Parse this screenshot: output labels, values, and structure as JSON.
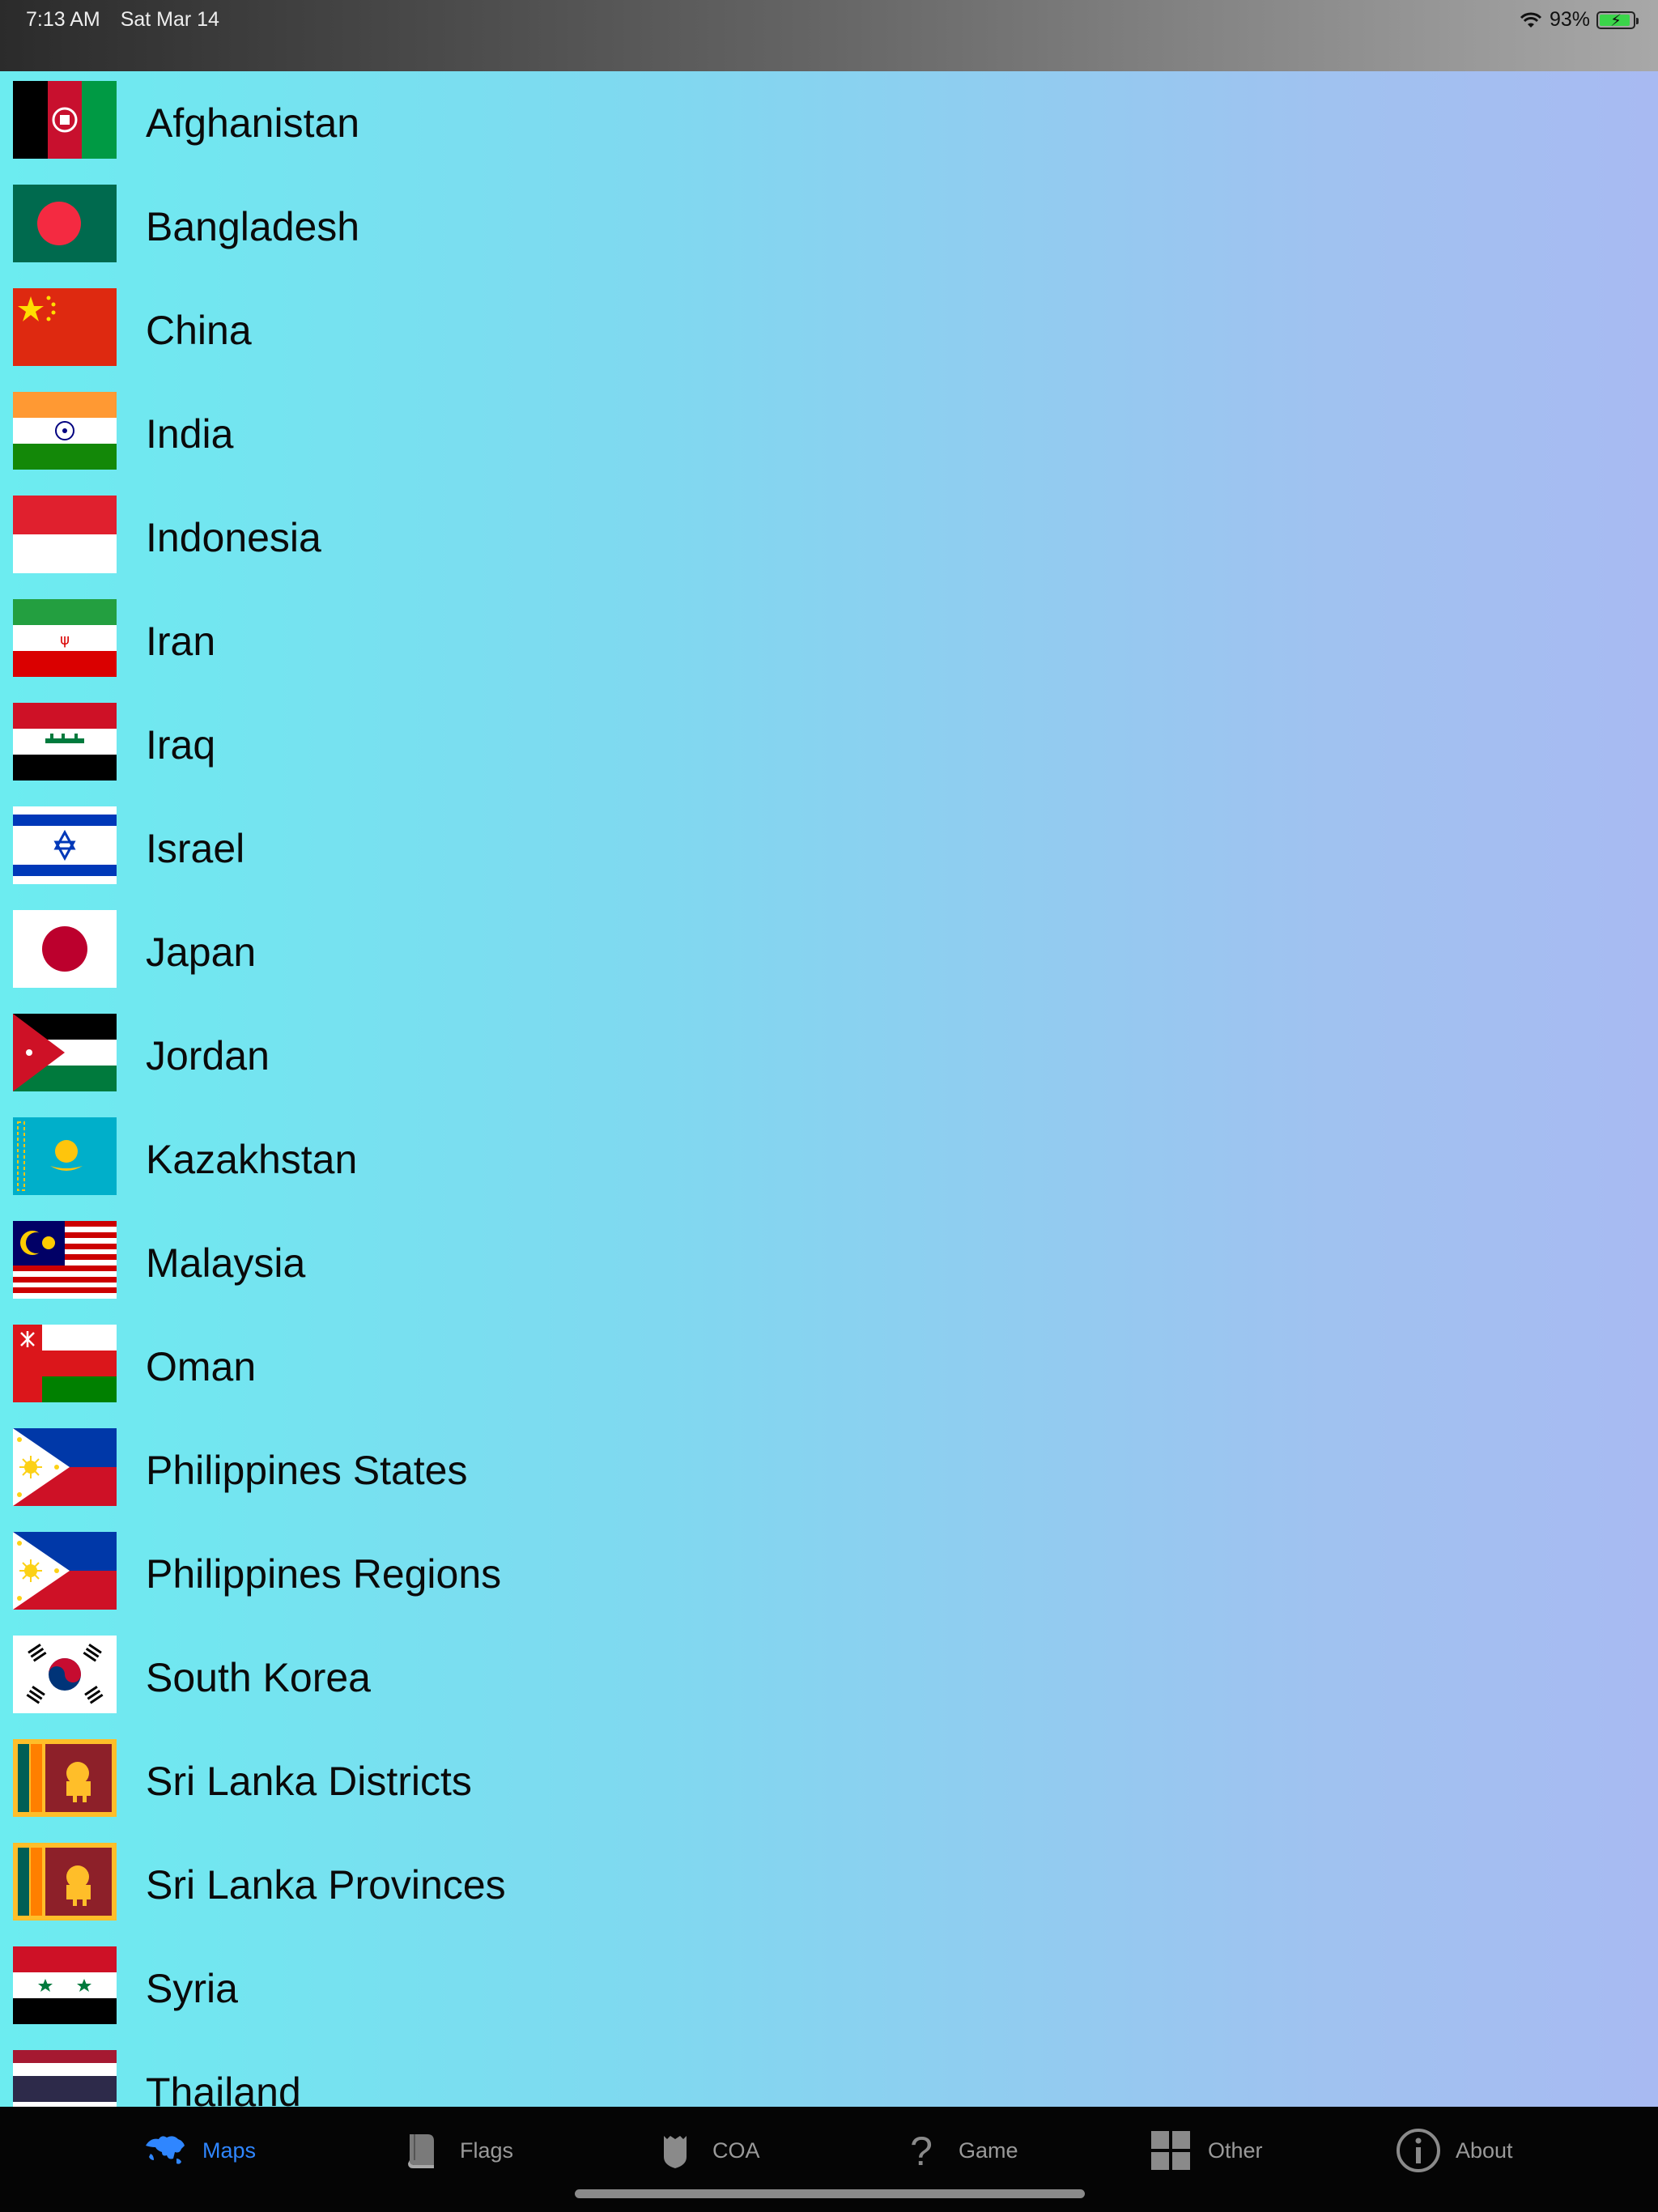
{
  "status_bar": {
    "time": "7:13 AM",
    "date": "Sat Mar 14",
    "battery_percent": "93%",
    "battery_level": 0.93,
    "wifi_icon": "wifi-icon",
    "battery_icon": "battery-charging-icon"
  },
  "countries": [
    {
      "name": "Afghanistan",
      "flag": "afghanistan-flag"
    },
    {
      "name": "Bangladesh",
      "flag": "bangladesh-flag"
    },
    {
      "name": "China",
      "flag": "china-flag"
    },
    {
      "name": "India",
      "flag": "india-flag"
    },
    {
      "name": "Indonesia",
      "flag": "indonesia-flag"
    },
    {
      "name": "Iran",
      "flag": "iran-flag"
    },
    {
      "name": "Iraq",
      "flag": "iraq-flag"
    },
    {
      "name": "Israel",
      "flag": "israel-flag"
    },
    {
      "name": "Japan",
      "flag": "japan-flag"
    },
    {
      "name": "Jordan",
      "flag": "jordan-flag"
    },
    {
      "name": "Kazakhstan",
      "flag": "kazakhstan-flag"
    },
    {
      "name": "Malaysia",
      "flag": "malaysia-flag"
    },
    {
      "name": "Oman",
      "flag": "oman-flag"
    },
    {
      "name": "Philippines States",
      "flag": "philippines-flag"
    },
    {
      "name": "Philippines Regions",
      "flag": "philippines-flag"
    },
    {
      "name": "South Korea",
      "flag": "south-korea-flag"
    },
    {
      "name": "Sri Lanka Districts",
      "flag": "sri-lanka-flag"
    },
    {
      "name": "Sri Lanka Provinces",
      "flag": "sri-lanka-flag"
    },
    {
      "name": "Syria",
      "flag": "syria-flag"
    },
    {
      "name": "Thailand",
      "flag": "thailand-flag"
    }
  ],
  "tabs": [
    {
      "label": "Maps",
      "icon": "world-map-icon",
      "active": true
    },
    {
      "label": "Flags",
      "icon": "book-icon",
      "active": false
    },
    {
      "label": "COA",
      "icon": "shield-icon",
      "active": false
    },
    {
      "label": "Game",
      "icon": "question-mark-icon",
      "active": false
    },
    {
      "label": "Other",
      "icon": "grid-icon",
      "active": false
    },
    {
      "label": "About",
      "icon": "info-icon",
      "active": false
    }
  ],
  "colors": {
    "tab_active": "#2f86ff",
    "tab_inactive": "#9a9a9a",
    "tab_bar_bg": "#050505"
  }
}
